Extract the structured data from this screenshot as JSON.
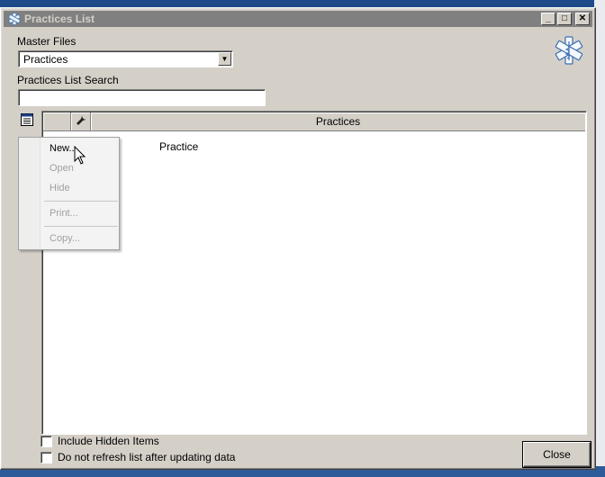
{
  "window": {
    "title": "Practices List"
  },
  "titlebar": {
    "minimize": "_",
    "maximize": "□",
    "close": "✕"
  },
  "master_files": {
    "label": "Master Files",
    "selected": "Practices"
  },
  "search": {
    "label": "Practices List Search",
    "value": ""
  },
  "grid": {
    "columns": [
      "",
      "",
      "Practices"
    ],
    "rows": [
      {
        "name": "Practice"
      }
    ]
  },
  "context_menu": {
    "items": [
      {
        "label": "New...",
        "enabled": true
      },
      {
        "label": "Open",
        "enabled": false
      },
      {
        "label": "Hide",
        "enabled": false
      },
      {
        "label": "Print...",
        "enabled": false
      },
      {
        "label": "Copy...",
        "enabled": false
      }
    ]
  },
  "options": {
    "include_hidden": {
      "label": "Include Hidden Items",
      "checked": false
    },
    "no_refresh": {
      "label": "Do not refresh list after updating data",
      "checked": false
    }
  },
  "buttons": {
    "close": "Close"
  },
  "icons": {
    "app": "medical-star-icon",
    "logo": "medical-star-icon",
    "list": "list-menu-icon",
    "column": "flashlight-icon"
  }
}
